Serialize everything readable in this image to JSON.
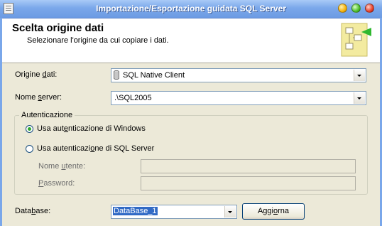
{
  "window": {
    "title": "Importazione/Esportazione guidata SQL Server"
  },
  "header": {
    "title": "Scelta origine dati",
    "subtitle": "Selezionare l'origine da cui copiare i dati."
  },
  "source": {
    "label_pre": "Origine ",
    "label_key": "d",
    "label_post": "ati:",
    "value": "SQL Native Client"
  },
  "server": {
    "label_pre": "Nome ",
    "label_key": "s",
    "label_post": "erver:",
    "value": ".\\SQL2005"
  },
  "auth": {
    "legend": "Autenticazione",
    "windows": {
      "pre": "Usa aut",
      "key": "e",
      "post": "nticazione di Windows",
      "selected": true
    },
    "sql": {
      "pre": "Usa autenticazi",
      "key": "o",
      "post": "ne di SQL Server",
      "selected": false
    },
    "username": {
      "pre": "Nome ",
      "key": "u",
      "post": "tente:",
      "value": ""
    },
    "password": {
      "pre": "",
      "key": "P",
      "post": "assword:",
      "value": ""
    }
  },
  "database": {
    "label_pre": "Data",
    "label_key": "b",
    "label_post": "ase:",
    "value": "DataBase_1"
  },
  "refresh": {
    "pre": "Aggi",
    "key": "o",
    "post": "rna"
  },
  "colors": {
    "titlebar": "#7AA7EA",
    "background": "#ECE9D8",
    "radio_selected": "#2FA82F",
    "selection": "#316AC5"
  }
}
